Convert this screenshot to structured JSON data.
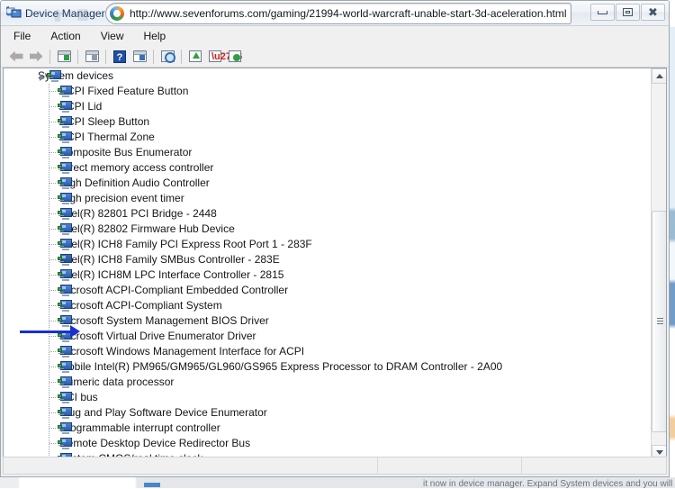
{
  "window": {
    "app_title": "Device Manager",
    "app_icon": "device-manager-icon",
    "url": "http://www.sevenforums.com/gaming/21994-world-warcraft-unable-start-3d-aceleration.html",
    "url_icon": "firefox-icon",
    "buttons": {
      "minimize": "minimize-button",
      "maximize": "restore-button",
      "close": "close-button",
      "close_glyph": "✖"
    }
  },
  "menubar": {
    "items": [
      {
        "label": "File"
      },
      {
        "label": "Action"
      },
      {
        "label": "View"
      },
      {
        "label": "Help"
      }
    ]
  },
  "toolbar": {
    "items": [
      {
        "name": "back-arrow-icon"
      },
      {
        "name": "forward-arrow-icon"
      },
      {
        "name": "separator"
      },
      {
        "name": "show-hide-console-tree-icon"
      },
      {
        "name": "separator"
      },
      {
        "name": "properties-icon"
      },
      {
        "name": "separator"
      },
      {
        "name": "help-icon",
        "glyph": "?"
      },
      {
        "name": "show-hide-action-pane-icon"
      },
      {
        "name": "separator"
      },
      {
        "name": "scan-for-hardware-changes-icon"
      },
      {
        "name": "separator"
      },
      {
        "name": "update-driver-icon"
      },
      {
        "name": "uninstall-device-icon"
      },
      {
        "name": "disable-device-icon"
      }
    ]
  },
  "tree": {
    "root": {
      "label": "System devices",
      "icon": "system-device-icon",
      "expanded": true
    },
    "children": [
      {
        "label": "ACPI Fixed Feature Button",
        "icon": "system-device-icon"
      },
      {
        "label": "ACPI Lid",
        "icon": "system-device-icon"
      },
      {
        "label": "ACPI Sleep Button",
        "icon": "system-device-icon"
      },
      {
        "label": "ACPI Thermal Zone",
        "icon": "system-device-icon"
      },
      {
        "label": "Composite Bus Enumerator",
        "icon": "system-device-icon"
      },
      {
        "label": "Direct memory access controller",
        "icon": "system-device-icon"
      },
      {
        "label": "High Definition Audio Controller",
        "icon": "system-device-icon"
      },
      {
        "label": "High precision event timer",
        "icon": "system-device-icon"
      },
      {
        "label": "Intel(R) 82801 PCI Bridge - 2448",
        "icon": "system-device-icon"
      },
      {
        "label": "Intel(R) 82802 Firmware Hub Device",
        "icon": "system-device-icon"
      },
      {
        "label": "Intel(R) ICH8 Family PCI Express Root Port 1 - 283F",
        "icon": "system-device-icon"
      },
      {
        "label": "Intel(R) ICH8 Family SMBus Controller - 283E",
        "icon": "system-device-icon",
        "annotated": true
      },
      {
        "label": "Intel(R) ICH8M LPC Interface Controller - 2815",
        "icon": "system-device-icon"
      },
      {
        "label": "Microsoft ACPI-Compliant Embedded Controller",
        "icon": "system-device-icon"
      },
      {
        "label": "Microsoft ACPI-Compliant System",
        "icon": "system-device-icon"
      },
      {
        "label": "Microsoft System Management BIOS Driver",
        "icon": "system-device-icon"
      },
      {
        "label": "Microsoft Virtual Drive Enumerator Driver",
        "icon": "system-device-icon"
      },
      {
        "label": "Microsoft Windows Management Interface for ACPI",
        "icon": "system-device-icon"
      },
      {
        "label": "Mobile Intel(R) PM965/GM965/GL960/GS965 Express Processor to DRAM Controller - 2A00",
        "icon": "system-device-icon"
      },
      {
        "label": "Numeric data processor",
        "icon": "system-device-icon"
      },
      {
        "label": "PCI bus",
        "icon": "system-device-icon"
      },
      {
        "label": "Plug and Play Software Device Enumerator",
        "icon": "system-device-icon"
      },
      {
        "label": "Programmable interrupt controller",
        "icon": "system-device-icon"
      },
      {
        "label": "Remote Desktop Device Redirector Bus",
        "icon": "system-device-icon"
      },
      {
        "label": "System CMOS/real time clock",
        "icon": "system-device-icon"
      }
    ]
  },
  "annotation": {
    "type": "arrow",
    "color": "#1a2fd0",
    "points_to": "Intel(R) ICH8 Family SMBus Controller - 283E"
  },
  "scrollbar": {
    "up_arrow": "scroll-up-arrow",
    "down_arrow": "scroll-down-arrow",
    "thumb": "scroll-thumb"
  },
  "statusbar": {
    "cells": [
      "",
      "",
      ""
    ]
  },
  "background_page": {
    "ghost_text": "it now in device manager. Expand System devices and you will see the name like this"
  }
}
